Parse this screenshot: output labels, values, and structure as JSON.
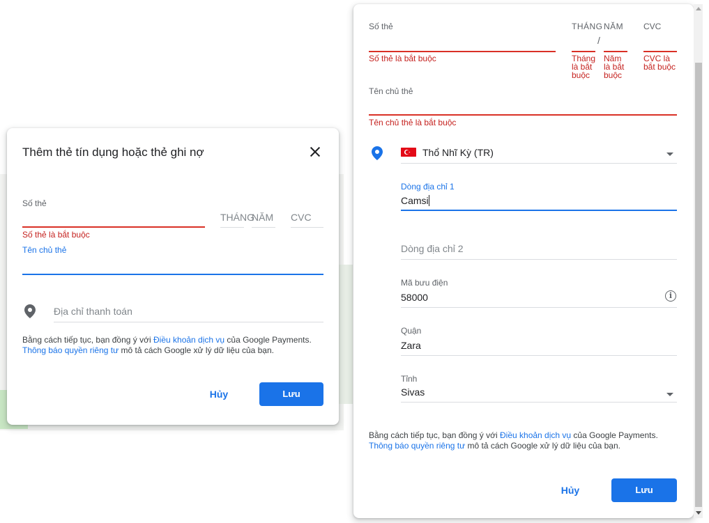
{
  "dialog1": {
    "title": "Thêm thẻ tín dụng hoặc thẻ ghi nợ",
    "card_number_label": "Số thẻ",
    "card_number_error": "Số thẻ là bắt buộc",
    "month_placeholder": "THÁNG",
    "year_placeholder": "NĂM",
    "cvc_placeholder": "CVC",
    "cardholder_label": "Tên chủ thẻ",
    "billing_address_placeholder": "Địa chỉ thanh toán",
    "legal": {
      "prefix": "Bằng cách tiếp tục, bạn đồng ý với ",
      "terms_link": "Điều khoản dịch vụ",
      "middle": " của Google Payments. ",
      "privacy_link": "Thông báo quyền riêng tư",
      "suffix": " mô tả cách Google xử lý dữ liệu của bạn."
    },
    "cancel_label": "Hủy",
    "save_label": "Lưu"
  },
  "dialog2": {
    "card_number_label": "Số thẻ",
    "card_number_error": "Số thẻ là bắt buộc",
    "month_label": "THÁNG",
    "year_label": "NĂM",
    "separator": "/",
    "cvc_label": "CVC",
    "month_error": "Tháng là bắt buộc",
    "year_error": "Năm là bắt buộc",
    "cvc_error": "CVC là bắt buộc",
    "cardholder_label": "Tên chủ thẻ",
    "cardholder_error": "Tên chủ thẻ là bắt buộc",
    "country_value": "Thổ Nhĩ Kỳ (TR)",
    "address1_label": "Dòng địa chỉ 1",
    "address1_value": "Camsi",
    "address2_placeholder": "Dòng địa chỉ 2",
    "postal_label": "Mã bưu điện",
    "postal_value": "58000",
    "district_label": "Quận",
    "district_value": "Zara",
    "province_label": "Tỉnh",
    "province_value": "Sivas",
    "legal": {
      "prefix": "Bằng cách tiếp tục, bạn đồng ý với ",
      "terms_link": "Điều khoản dịch vụ",
      "middle": " của Google Payments. ",
      "privacy_link": "Thông báo quyền riêng tư",
      "suffix": " mô tả cách Google xử lý dữ liệu của bạn."
    },
    "cancel_label": "Hủy",
    "save_label": "Lưu"
  },
  "colors": {
    "accent": "#1a73e8",
    "error": "#d93025",
    "flag": "#e30a17"
  },
  "icons": [
    "close-icon",
    "location-pin-icon",
    "chevron-down-icon",
    "info-icon",
    "turkey-flag-icon"
  ]
}
